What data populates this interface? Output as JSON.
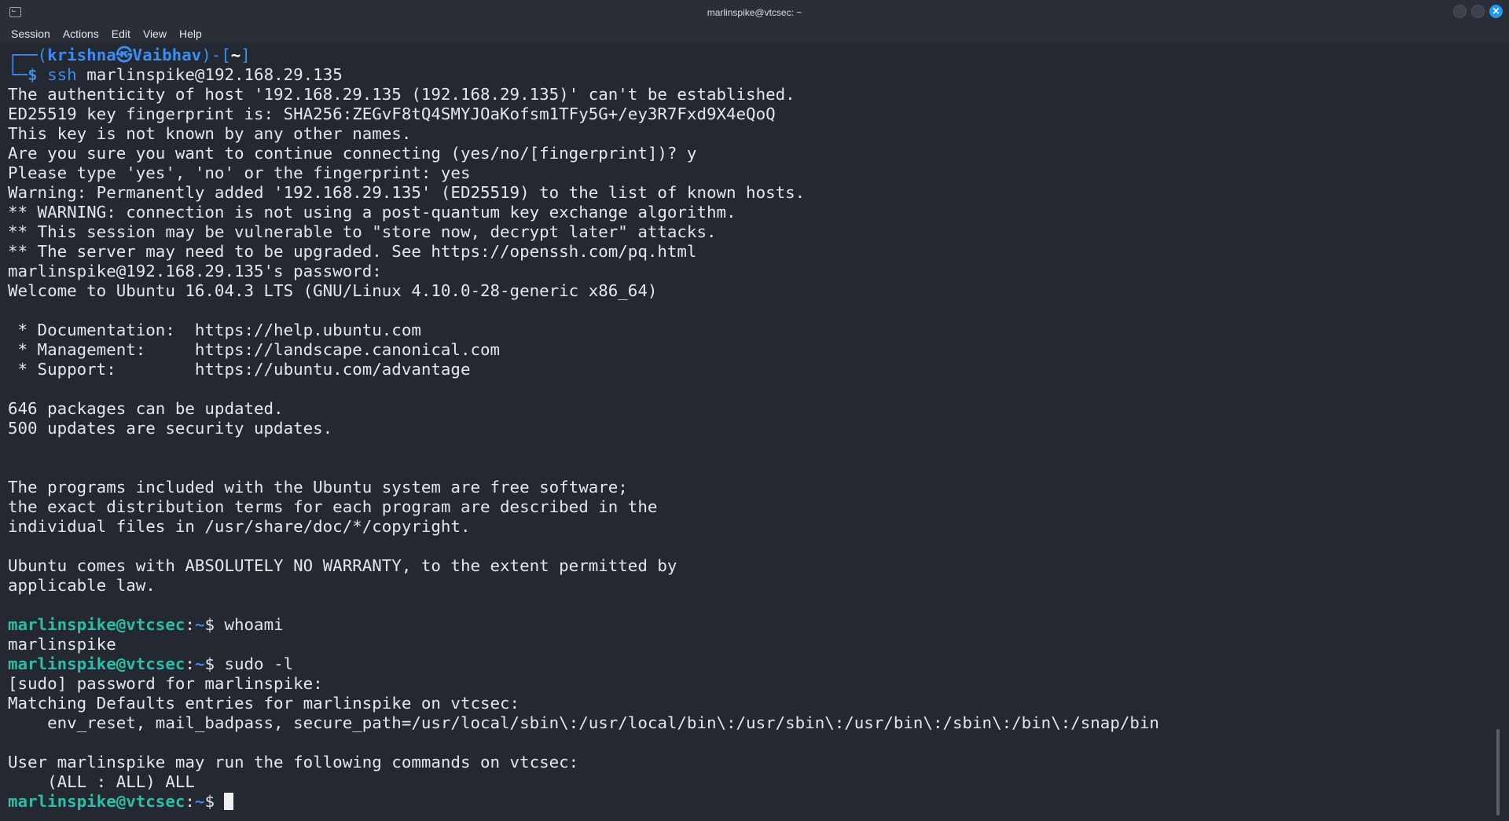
{
  "window": {
    "title": "marlinspike@vtcsec: ~"
  },
  "menu": [
    "Session",
    "Actions",
    "Edit",
    "View",
    "Help"
  ],
  "prompt_local": {
    "top": "┌──(",
    "user": "krishna",
    "at": "㉿",
    "host": "Vaibhav",
    "mid": ")-[",
    "dir": "~",
    "end": "]",
    "bottom": "└─",
    "dollar": "$",
    "cmd_name": "ssh",
    "cmd_args": " marlinspike@192.168.29.135"
  },
  "ssh_output": [
    "The authenticity of host '192.168.29.135 (192.168.29.135)' can't be established.",
    "ED25519 key fingerprint is: SHA256:ZEGvF8tQ4SMYJOaKofsm1TFy5G+/ey3R7Fxd9X4eQoQ",
    "This key is not known by any other names.",
    "Are you sure you want to continue connecting (yes/no/[fingerprint])? y",
    "Please type 'yes', 'no' or the fingerprint: yes",
    "Warning: Permanently added '192.168.29.135' (ED25519) to the list of known hosts.",
    "** WARNING: connection is not using a post-quantum key exchange algorithm.",
    "** This session may be vulnerable to \"store now, decrypt later\" attacks.",
    "** The server may need to be upgraded. See https://openssh.com/pq.html",
    "marlinspike@192.168.29.135's password:",
    "Welcome to Ubuntu 16.04.3 LTS (GNU/Linux 4.10.0-28-generic x86_64)",
    "",
    " * Documentation:  https://help.ubuntu.com",
    " * Management:     https://landscape.canonical.com",
    " * Support:        https://ubuntu.com/advantage",
    "",
    "646 packages can be updated.",
    "500 updates are security updates.",
    "",
    "",
    "The programs included with the Ubuntu system are free software;",
    "the exact distribution terms for each program are described in the",
    "individual files in /usr/share/doc/*/copyright.",
    "",
    "Ubuntu comes with ABSOLUTELY NO WARRANTY, to the extent permitted by",
    "applicable law.",
    ""
  ],
  "remote_prompt": {
    "user_host": "marlinspike@vtcsec",
    "colon": ":",
    "dir": "~",
    "dollar": "$ "
  },
  "commands": {
    "whoami": "whoami",
    "whoami_out": "marlinspike",
    "sudo": "sudo -l"
  },
  "sudo_output": [
    "[sudo] password for marlinspike:",
    "Matching Defaults entries for marlinspike on vtcsec:",
    "    env_reset, mail_badpass, secure_path=/usr/local/sbin\\:/usr/local/bin\\:/usr/sbin\\:/usr/bin\\:/sbin\\:/bin\\:/snap/bin",
    "",
    "User marlinspike may run the following commands on vtcsec:",
    "    (ALL : ALL) ALL"
  ],
  "icons": {
    "app": "terminal-app-icon",
    "minimize": "minimize-icon",
    "maximize": "maximize-icon",
    "close": "close-icon"
  },
  "colors": {
    "background": "#242830",
    "prompt_user": "#2bbfa5",
    "prompt_path": "#3c8df3",
    "close_button": "#1d99f3"
  }
}
